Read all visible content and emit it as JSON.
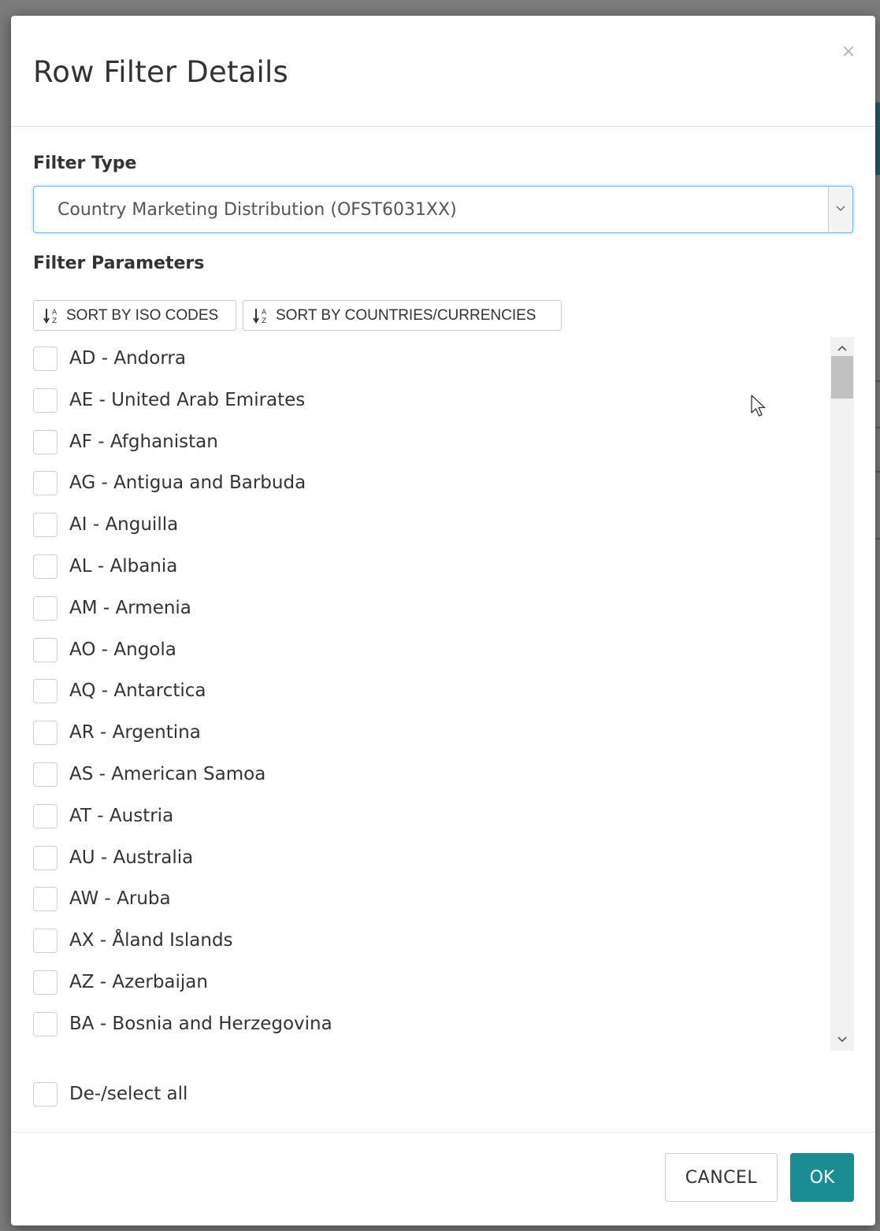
{
  "dialog": {
    "title": "Row Filter Details",
    "close_label": "×"
  },
  "filter_type": {
    "label": "Filter Type",
    "selected": "Country Marketing Distribution (OFST6031XX)"
  },
  "filter_parameters": {
    "label": "Filter Parameters",
    "sort_buttons": [
      {
        "label": "SORT BY ISO CODES",
        "icon": "sort-alpha-icon"
      },
      {
        "label": "SORT BY COUNTRIES/CURRENCIES",
        "icon": "sort-alpha-icon"
      }
    ],
    "items": [
      {
        "label": "AD - Andorra",
        "checked": false
      },
      {
        "label": "AE - United Arab Emirates",
        "checked": false
      },
      {
        "label": "AF - Afghanistan",
        "checked": false
      },
      {
        "label": "AG - Antigua and Barbuda",
        "checked": false
      },
      {
        "label": "AI - Anguilla",
        "checked": false
      },
      {
        "label": "AL - Albania",
        "checked": false
      },
      {
        "label": "AM - Armenia",
        "checked": false
      },
      {
        "label": "AO - Angola",
        "checked": false
      },
      {
        "label": "AQ - Antarctica",
        "checked": false
      },
      {
        "label": "AR - Argentina",
        "checked": false
      },
      {
        "label": "AS - American Samoa",
        "checked": false
      },
      {
        "label": "AT - Austria",
        "checked": false
      },
      {
        "label": "AU - Australia",
        "checked": false
      },
      {
        "label": "AW - Aruba",
        "checked": false
      },
      {
        "label": "AX - Åland Islands",
        "checked": false
      },
      {
        "label": "AZ - Azerbaijan",
        "checked": false
      },
      {
        "label": "BA - Bosnia and Herzegovina",
        "checked": false
      },
      {
        "label": "",
        "checked": false
      }
    ],
    "select_all_label": "De-/select all"
  },
  "footer": {
    "cancel_label": "CANCEL",
    "ok_label": "OK"
  },
  "colors": {
    "primary": "#1a8c93",
    "focus_border": "#7db8e0",
    "backdrop": "#7b7b7b"
  }
}
